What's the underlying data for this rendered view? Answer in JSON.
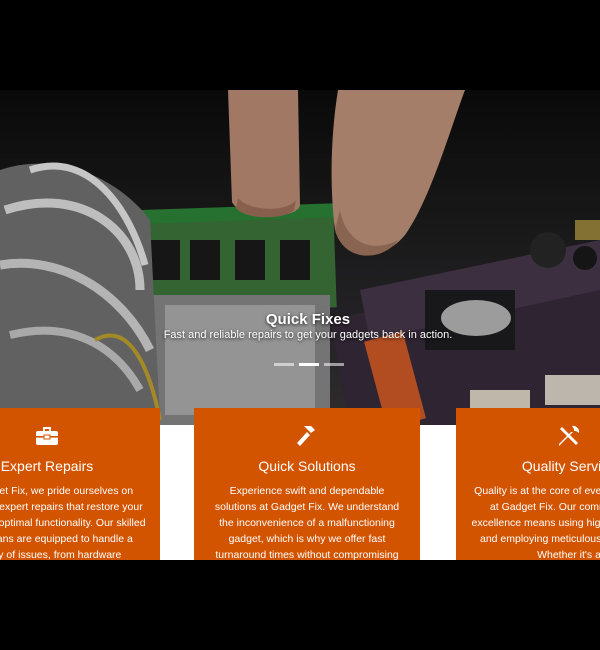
{
  "hero": {
    "title": "Quick Fixes",
    "subtitle": "Fast and reliable repairs to get your gadgets back in action.",
    "slides": 3,
    "active_slide": 2
  },
  "cards": [
    {
      "icon": "toolbox-icon",
      "title": "Expert Repairs",
      "text": "At Gadget Fix, we pride ourselves on delivering expert repairs that restore your devices to optimal functionality. Our skilled technicians are equipped to handle a variety of issues, from hardware"
    },
    {
      "icon": "hammer-icon",
      "title": "Quick Solutions",
      "text": "Experience swift and dependable solutions at Gadget Fix. We understand the inconvenience of a malfunctioning gadget, which is why we offer fast turnaround times without compromising"
    },
    {
      "icon": "tools-icon",
      "title": "Quality Service",
      "text": "Quality is at the core of everything we do at Gadget Fix. Our commitment to excellence means using high-quality parts and employing meticulous techniques. Whether it's a"
    }
  ],
  "colors": {
    "accent": "#d35400",
    "background": "#000000"
  }
}
